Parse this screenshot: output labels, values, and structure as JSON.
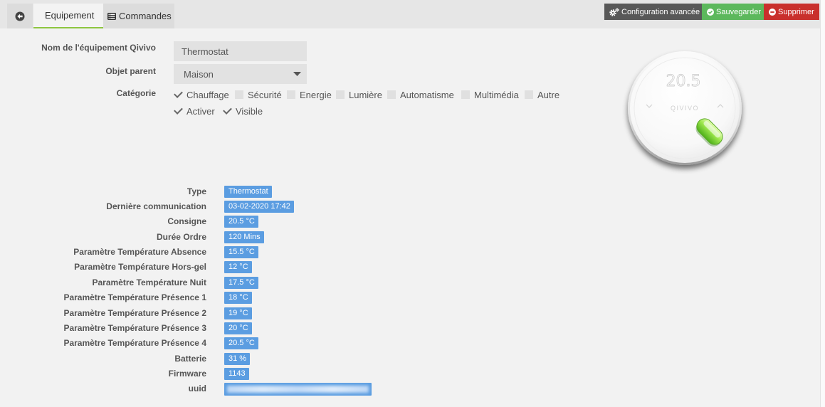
{
  "nav": {
    "back": {
      "icon": "arrow-circle-left-icon"
    },
    "tabs": [
      {
        "label": "Equipement",
        "active": true
      },
      {
        "label": "Commandes",
        "icon": "list-alt-icon",
        "active": false
      }
    ],
    "active_tab_underline_color": "#8dc63f"
  },
  "actions": {
    "advanced_config": {
      "label": "Configuration avancée",
      "icon": "cogs-icon",
      "color": "#585858"
    },
    "save": {
      "label": "Sauvegarder",
      "icon": "check-circle-icon",
      "color": "#5cb85c"
    },
    "delete": {
      "label": "Supprimer",
      "icon": "minus-circle-icon",
      "color": "#c9302c"
    }
  },
  "form": {
    "name": {
      "label": "Nom de l'équipement Qivivo",
      "value": "Thermostat"
    },
    "parent": {
      "label": "Objet parent",
      "value": "Maison"
    },
    "category": {
      "label": "Catégorie",
      "options": [
        {
          "label": "Chauffage",
          "checked": true
        },
        {
          "label": "Sécurité",
          "checked": false
        },
        {
          "label": "Energie",
          "checked": false
        },
        {
          "label": "Lumière",
          "checked": false
        },
        {
          "label": "Automatisme",
          "checked": false
        },
        {
          "label": "Multimédia",
          "checked": false
        },
        {
          "label": "Autre",
          "checked": false
        }
      ]
    },
    "flags": [
      {
        "label": "Activer",
        "checked": true
      },
      {
        "label": "Visible",
        "checked": true
      }
    ]
  },
  "device_image": {
    "display": "20.5",
    "brand": "QIVIVO"
  },
  "info": {
    "badge_color": "#5b9de1",
    "rows": [
      {
        "label": "Type",
        "value": "Thermostat"
      },
      {
        "label": "Dernière communication",
        "value": "03-02-2020 17:42"
      },
      {
        "label": "Consigne",
        "value": "20.5 °C"
      },
      {
        "label": "Durée Ordre",
        "value": "120 Mins"
      },
      {
        "label": "Paramètre Température Absence",
        "value": "15.5 °C"
      },
      {
        "label": "Paramètre Température Hors-gel",
        "value": "12 °C"
      },
      {
        "label": "Paramètre Température Nuit",
        "value": "17.5 °C"
      },
      {
        "label": "Paramètre Température Présence 1",
        "value": "18 °C"
      },
      {
        "label": "Paramètre Température Présence 2",
        "value": "19 °C"
      },
      {
        "label": "Paramètre Température Présence 3",
        "value": "20 °C"
      },
      {
        "label": "Paramètre Température Présence 4",
        "value": "20.5 °C"
      },
      {
        "label": "Batterie",
        "value": "31 %"
      },
      {
        "label": "Firmware",
        "value": "1143"
      },
      {
        "label": "uuid",
        "blurred": true
      }
    ]
  }
}
